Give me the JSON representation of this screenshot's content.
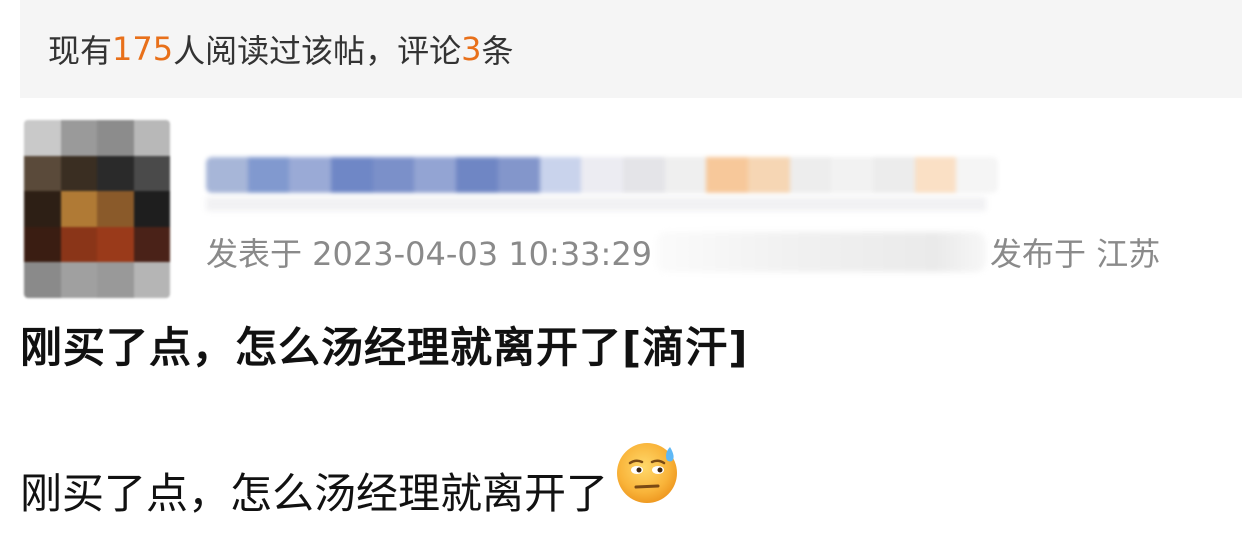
{
  "stats": {
    "prefix": "现有",
    "read_count": "175",
    "middle": "人阅读过该帖，评论",
    "comment_count": "3",
    "suffix": "条"
  },
  "post": {
    "date_label": "发表于 2023-04-03 10:33:29",
    "location_label": "发布于 江苏"
  },
  "comment": {
    "title": "刚买了点，怎么汤经理就离开了[滴汗]",
    "body": "刚买了点，怎么汤经理就离开了",
    "emoji_icon": "sweat-emoji-icon"
  },
  "colors": {
    "highlight": "#e8701a",
    "stats_bg": "#f5f5f5",
    "meta_text": "#8a8a8a"
  }
}
